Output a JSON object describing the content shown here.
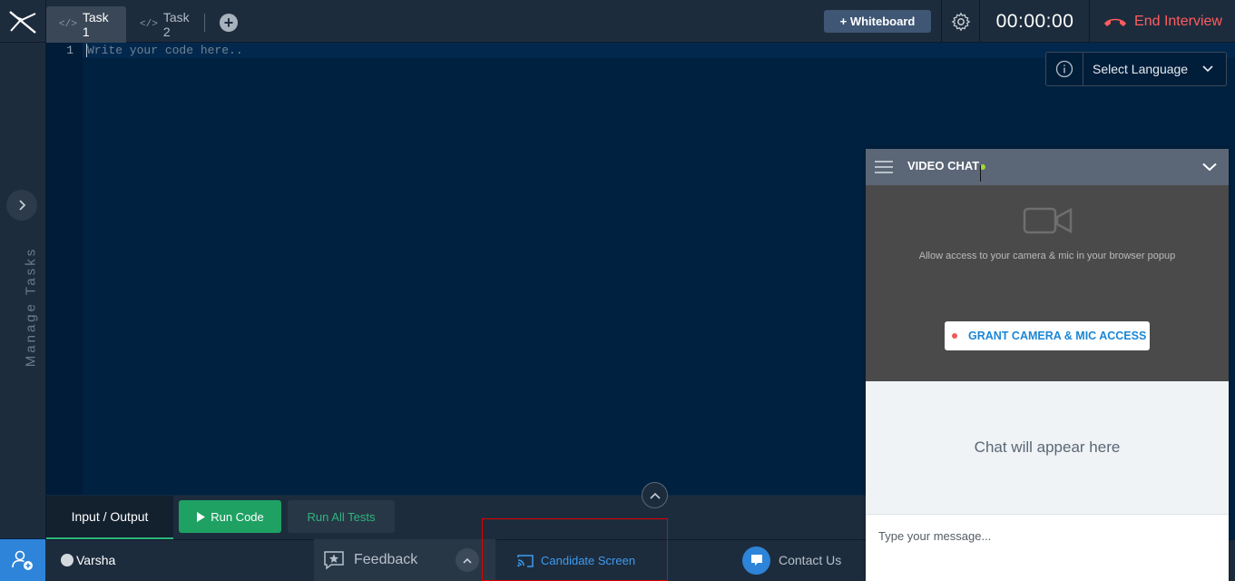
{
  "tabs": [
    {
      "label": "Task 1",
      "active": true
    },
    {
      "label": "Task 2",
      "active": false
    }
  ],
  "toolbar": {
    "whiteboard_label": "+ Whiteboard",
    "timer": "00:00:00",
    "end_interview_label": "End Interview"
  },
  "sidebar": {
    "manage_tasks_label": "Manage Tasks"
  },
  "editor": {
    "line_number": "1",
    "placeholder": "Write your code here..",
    "language_select": "Select Language"
  },
  "io": {
    "tab_label": "Input / Output",
    "run_code_label": "Run Code",
    "run_all_label": "Run All Tests"
  },
  "status": {
    "user_name": "Varsha",
    "feedback_label": "Feedback",
    "candidate_screen_label": "Candidate Screen",
    "contact_label": "Contact Us"
  },
  "video_chat": {
    "title": "VIDEO CHAT",
    "allow_text": "Allow access to your camera & mic in your browser popup",
    "grant_label": "GRANT CAMERA & MIC ACCESS",
    "chat_placeholder_text": "Chat will appear here",
    "input_placeholder": "Type your message..."
  },
  "colors": {
    "editor_bg": "#002140",
    "accent_green": "#1ea163",
    "end_red": "#ff5d5d",
    "link_blue": "#3d9bef"
  }
}
